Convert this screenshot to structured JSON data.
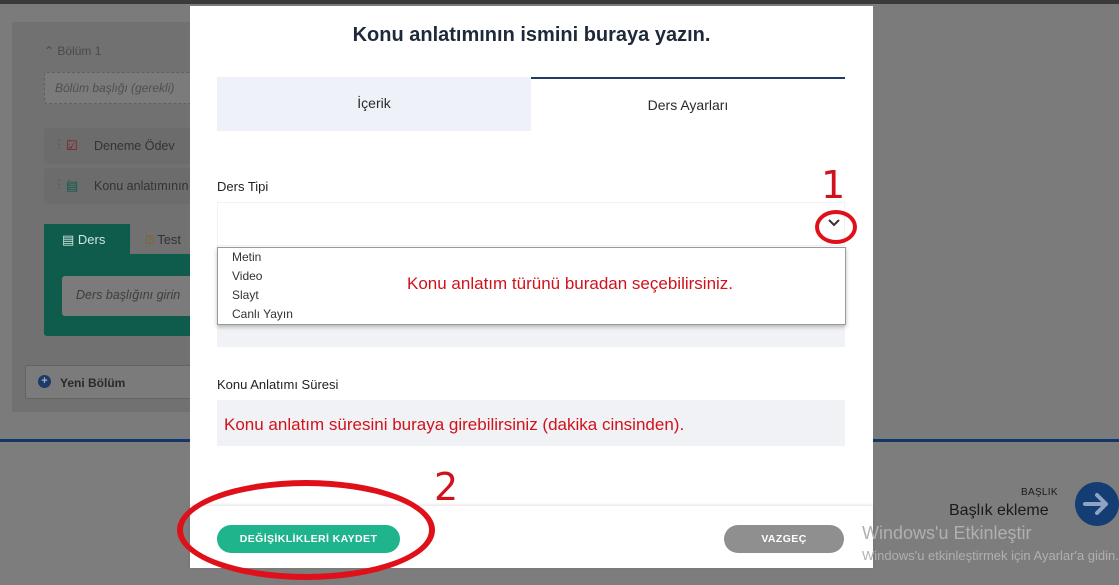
{
  "background": {
    "section_header": "Bölüm 1",
    "section_title_placeholder": "Bölüm başlığı (gerekli)",
    "items": [
      {
        "label": "Deneme Ödev"
      },
      {
        "label": "Konu anlatımının ismini buraya yazın."
      }
    ],
    "tabs": {
      "ders": "Ders",
      "test": "Test"
    },
    "lesson_title_placeholder": "Ders başlığını girin",
    "new_section": "Yeni Bölüm",
    "next": {
      "small": "BAŞLIK",
      "title": "Başlık ekleme"
    }
  },
  "modal": {
    "title": "Konu anlatımının ismini buraya yazın.",
    "tabs": {
      "content": "İçerik",
      "settings": "Ders Ayarları"
    },
    "lesson_type_label": "Ders Tipi",
    "options": [
      "Metin",
      "Video",
      "Slayt",
      "Canlı Yayın"
    ],
    "duration_label": "Konu Anlatımı Süresi",
    "save_label": "DEĞİŞİKLİKLERİ KAYDET",
    "cancel_label": "VAZGEÇ"
  },
  "annotations": {
    "num1": "1",
    "num2": "2",
    "type_note": "Konu anlatım türünü buradan seçebilirsiniz.",
    "duration_note": "Konu anlatım süresini buraya girebilirsiniz (dakika cinsinden)."
  },
  "watermark": {
    "line1": "Windows'u Etkinleştir",
    "line2": "Windows'u etkinleştirmek için Ayarlar'a gidin."
  },
  "colors": {
    "accent_green": "#20b48d",
    "navy": "#1f3b66",
    "annotation_red": "#d0121b",
    "cancel_grey": "#8f8f8f"
  }
}
